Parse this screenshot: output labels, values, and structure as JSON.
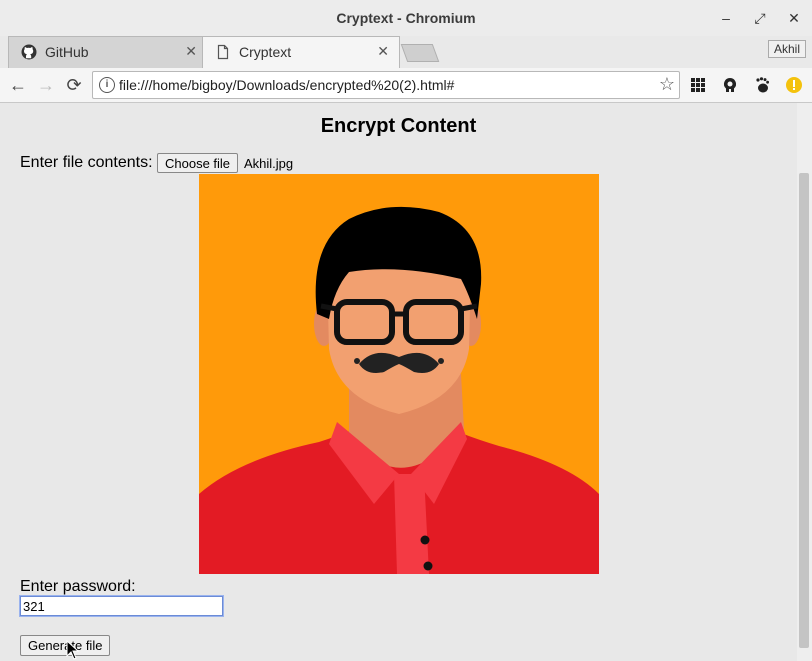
{
  "window": {
    "title": "Cryptext - Chromium",
    "minimize": "–",
    "maximize": "⤢",
    "close": "✕"
  },
  "tabs": [
    {
      "label": "GitHub",
      "close": "✕"
    },
    {
      "label": "Cryptext",
      "close": "✕"
    }
  ],
  "profile": "Akhil",
  "toolbar": {
    "back": "←",
    "forward": "→",
    "reload": "⟳",
    "info": "i",
    "url": "file:///home/bigboy/Downloads/encrypted%20(2).html#",
    "star": "☆"
  },
  "page": {
    "heading": "Encrypt Content",
    "file_label": "Enter file contents:",
    "choose_file_label": "Choose file",
    "file_name": "Akhil.jpg",
    "password_label": "Enter password:",
    "password_value": "321",
    "generate_label": "Generate file"
  },
  "colors": {
    "preview_bg": "#ff9a0a",
    "shirt": "#e31b24",
    "skin": "#f2a070",
    "hair": "#000000"
  }
}
